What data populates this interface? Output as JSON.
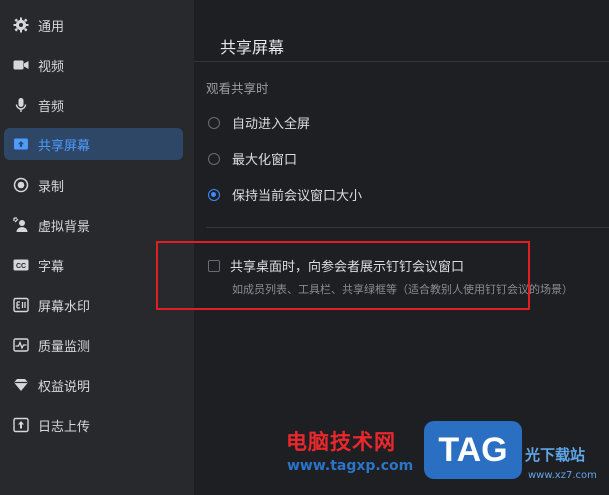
{
  "sidebar": {
    "items": [
      {
        "label": "通用",
        "icon": "gear-icon"
      },
      {
        "label": "视频",
        "icon": "video-camera-icon"
      },
      {
        "label": "音频",
        "icon": "microphone-icon"
      },
      {
        "label": "共享屏幕",
        "icon": "share-screen-icon",
        "active": true
      },
      {
        "label": "录制",
        "icon": "record-icon"
      },
      {
        "label": "虚拟背景",
        "icon": "virtual-background-icon"
      },
      {
        "label": "字幕",
        "icon": "captions-icon"
      },
      {
        "label": "屏幕水印",
        "icon": "watermark-icon"
      },
      {
        "label": "质量监测",
        "icon": "quality-monitor-icon"
      },
      {
        "label": "权益说明",
        "icon": "diamond-icon"
      },
      {
        "label": "日志上传",
        "icon": "upload-icon"
      }
    ]
  },
  "main": {
    "title": "共享屏幕",
    "section_label": "观看共享时",
    "radios": [
      {
        "label": "自动进入全屏",
        "checked": false
      },
      {
        "label": "最大化窗口",
        "checked": false
      },
      {
        "label": "保持当前会议窗口大小",
        "checked": true
      }
    ],
    "checkbox": {
      "label": "共享桌面时，向参会者展示钉钉会议窗口",
      "checked": false,
      "hint": "如成员列表、工具栏、共享绿框等（适合教别人使用钉钉会议的场景）"
    }
  },
  "watermark": {
    "name": "电脑技术网",
    "url": "www.tagxp.com",
    "tag": "TAG",
    "side": "光下载站",
    "side_url": "www.xz7.com"
  },
  "colors": {
    "accent": "#3c8cff",
    "active_bg": "#2f4766",
    "highlight": "#e02020"
  }
}
